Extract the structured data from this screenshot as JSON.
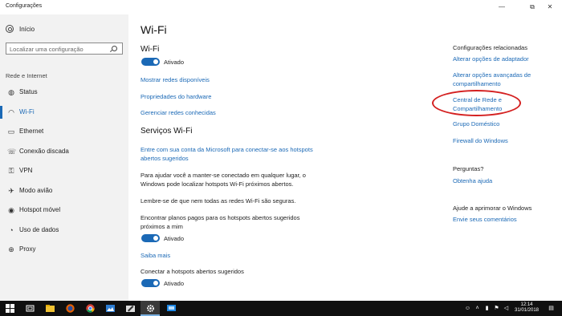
{
  "window": {
    "title": "Configurações",
    "minimize_glyph": "—",
    "maximize_glyph": "⧉",
    "close_glyph": "✕"
  },
  "sidebar": {
    "home_label": "Início",
    "search_placeholder": "Localizar uma configuração",
    "section_label": "Rede e Internet",
    "items": [
      {
        "label": "Status",
        "icon": "globe-icon",
        "glyph": "◍"
      },
      {
        "label": "Wi-Fi",
        "icon": "wifi-icon",
        "glyph": "◠"
      },
      {
        "label": "Ethernet",
        "icon": "ethernet-icon",
        "glyph": "▭"
      },
      {
        "label": "Conexão discada",
        "icon": "dialup-icon",
        "glyph": "☏"
      },
      {
        "label": "VPN",
        "icon": "vpn-icon",
        "glyph": "⚿"
      },
      {
        "label": "Modo avião",
        "icon": "airplane-icon",
        "glyph": "✈"
      },
      {
        "label": "Hotspot móvel",
        "icon": "hotspot-icon",
        "glyph": "◉"
      },
      {
        "label": "Uso de dados",
        "icon": "data-usage-icon",
        "glyph": "◔"
      },
      {
        "label": "Proxy",
        "icon": "proxy-icon",
        "glyph": "⊕"
      }
    ],
    "active_index": 1
  },
  "main": {
    "page_title": "Wi-Fi",
    "wifi_heading": "Wi-Fi",
    "wifi_toggle_label": "Ativado",
    "links": [
      "Mostrar redes disponíveis",
      "Propriedades do hardware",
      "Gerenciar redes conhecidas"
    ],
    "services_heading": "Serviços Wi-Fi",
    "microsoft_account_link_line1": "Entre com sua conta da Microsoft para conectar-se aos hotspots",
    "microsoft_account_link_line2": "abertos sugeridos",
    "help_text_line1": "Para ajudar você a manter-se conectado em qualquer lugar, o",
    "help_text_line2": "Windows pode localizar hotspots Wi-Fi próximos abertos.",
    "reminder_text": "Lembre-se de que nem todas as redes Wi-Fi são seguras.",
    "paid_plans_line1": "Encontrar planos pagos para os hotspots abertos sugeridos",
    "paid_plans_line2": "próximos a mim",
    "paid_plans_toggle_label": "Ativado",
    "learn_more_link": "Saiba mais",
    "connect_suggested_label": "Conectar a hotspots abertos sugeridos",
    "connect_suggested_toggle_label": "Ativado"
  },
  "related": {
    "heading": "Configurações relacionadas",
    "adapter_link": "Alterar opções de adaptador",
    "advanced_sharing_line1": "Alterar opções avançadas de",
    "advanced_sharing_line2": "compartilhamento",
    "network_center_line1": "Central de Rede e",
    "network_center_line2": "Compartilhamento",
    "homegroup_link": "Grupo Doméstico",
    "firewall_link": "Firewall do Windows",
    "questions_heading": "Perguntas?",
    "help_link": "Obtenha ajuda",
    "improve_heading": "Ajude a aprimorar o Windows",
    "feedback_link": "Envie seus comentários"
  },
  "taskbar": {
    "apps": [
      "start-icon",
      "task-view-icon",
      "file-explorer-icon",
      "firefox-icon",
      "chrome-icon",
      "photos-icon",
      "settings-icon",
      "remote-desktop-icon"
    ],
    "time": "12:14",
    "date": "31/01/2018"
  },
  "colors": {
    "accent": "#1b69b6",
    "annotation": "#d42020",
    "taskbar": "#101010"
  }
}
